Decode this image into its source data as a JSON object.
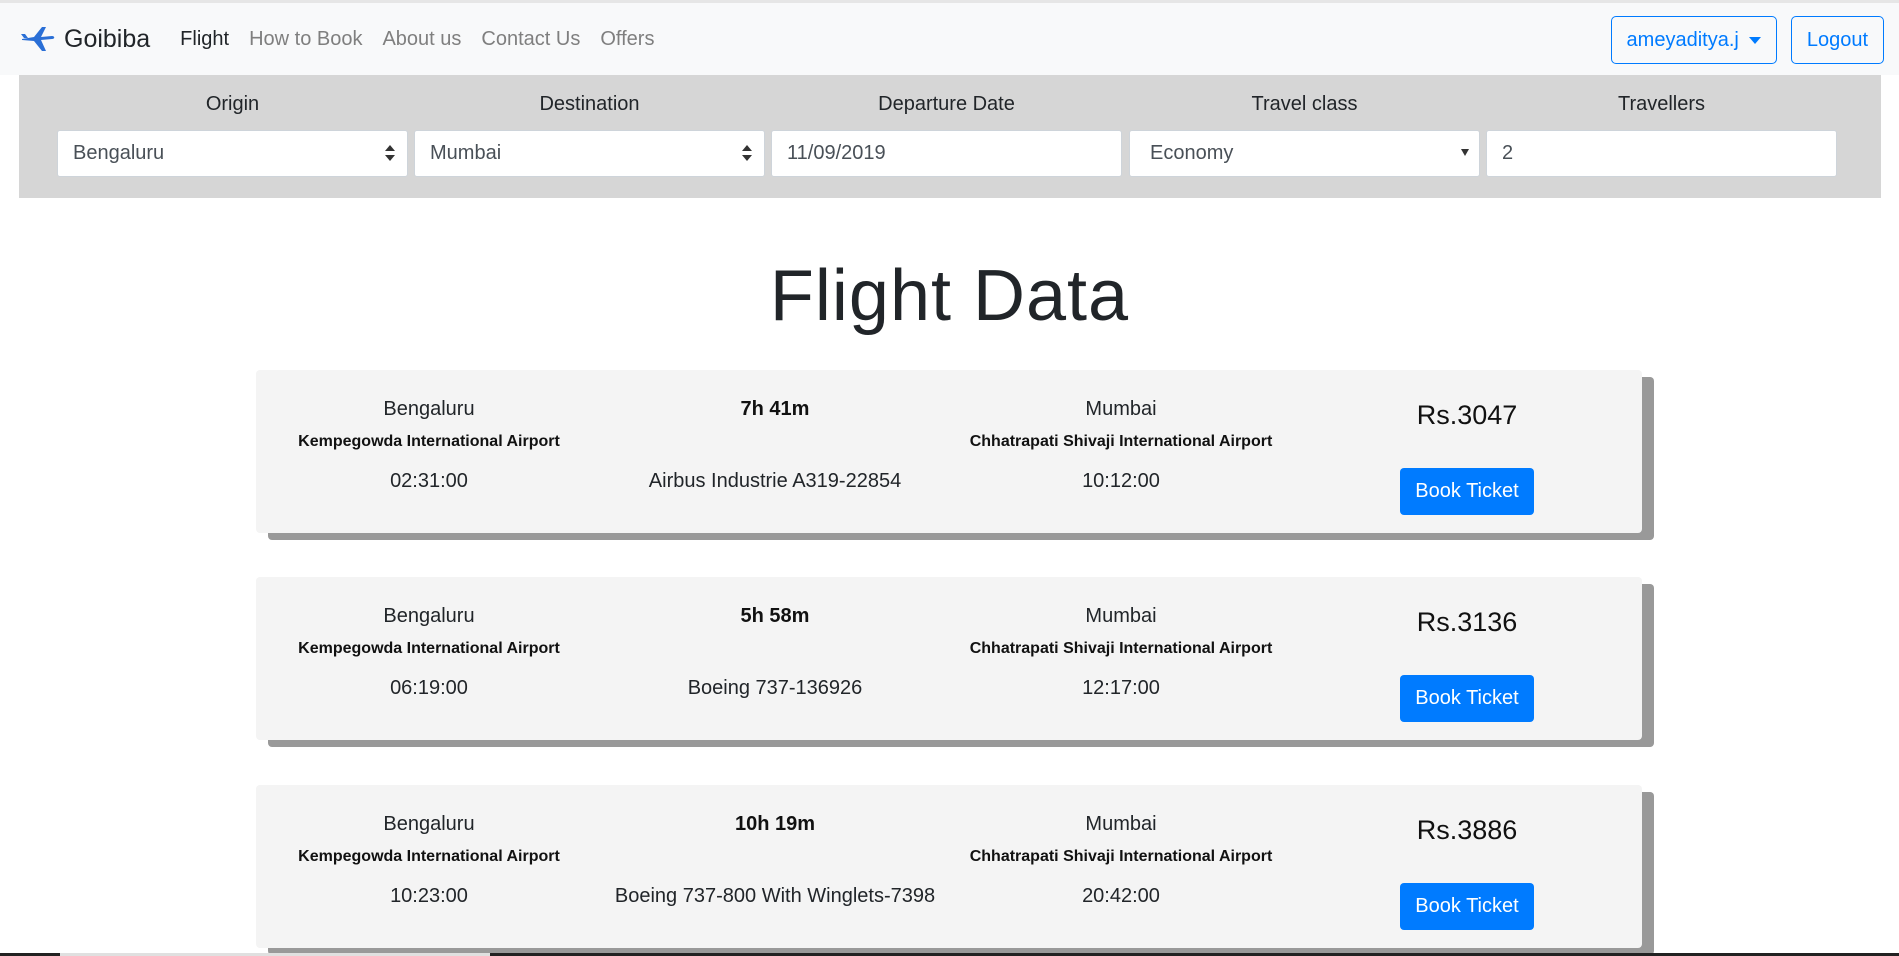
{
  "brand": {
    "name": "Goibiba",
    "logo_icon": "airplane-icon"
  },
  "nav": {
    "items": [
      {
        "label": "Flight",
        "active": true
      },
      {
        "label": "How to Book",
        "active": false
      },
      {
        "label": "About us",
        "active": false
      },
      {
        "label": "Contact Us",
        "active": false
      },
      {
        "label": "Offers",
        "active": false
      }
    ],
    "user_label": "ameyaditya.j",
    "logout_label": "Logout"
  },
  "search": {
    "origin": {
      "label": "Origin",
      "value": "Bengaluru"
    },
    "destination": {
      "label": "Destination",
      "value": "Mumbai"
    },
    "date": {
      "label": "Departure Date",
      "value": "11/09/2019"
    },
    "travel_class": {
      "label": "Travel class",
      "value": "Economy"
    },
    "travellers": {
      "label": "Travellers",
      "value": "2"
    }
  },
  "page_title": "Flight Data",
  "flights": [
    {
      "origin_city": "Bengaluru",
      "origin_airport": "Kempegowda International Airport",
      "departure": "02:31:00",
      "duration": "7h 41m",
      "aircraft": "Airbus Industrie A319-22854",
      "dest_city": "Mumbai",
      "dest_airport": "Chhatrapati Shivaji International Airport",
      "arrival": "10:12:00",
      "price": "Rs.3047",
      "book_label": "Book Ticket"
    },
    {
      "origin_city": "Bengaluru",
      "origin_airport": "Kempegowda International Airport",
      "departure": "06:19:00",
      "duration": "5h 58m",
      "aircraft": "Boeing 737-136926",
      "dest_city": "Mumbai",
      "dest_airport": "Chhatrapati Shivaji International Airport",
      "arrival": "12:17:00",
      "price": "Rs.3136",
      "book_label": "Book Ticket"
    },
    {
      "origin_city": "Bengaluru",
      "origin_airport": "Kempegowda International Airport",
      "departure": "10:23:00",
      "duration": "10h 19m",
      "aircraft": "Boeing 737-800 With Winglets-7398",
      "dest_city": "Mumbai",
      "dest_airport": "Chhatrapati Shivaji International Airport",
      "arrival": "20:42:00",
      "price": "Rs.3886",
      "book_label": "Book Ticket"
    }
  ],
  "colors": {
    "primary": "#007bff",
    "navbar_bg": "#f8f9fa",
    "search_bg": "#d6d6d6",
    "card_bg": "#f4f4f4"
  }
}
